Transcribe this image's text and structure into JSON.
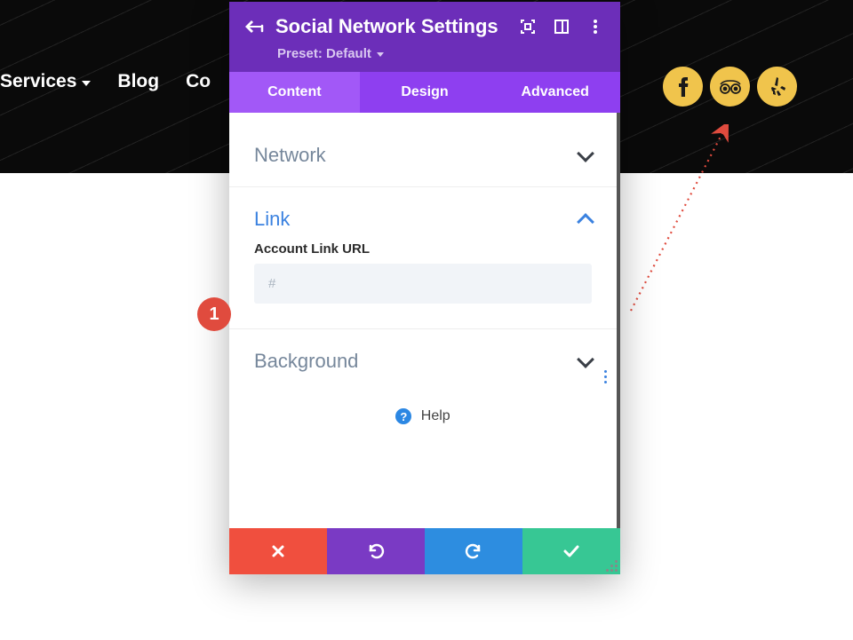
{
  "nav": {
    "items": [
      "Services",
      "Blog",
      "Co"
    ],
    "has_dropdown": [
      true,
      false,
      false
    ]
  },
  "social_icons": [
    "facebook",
    "tripadvisor",
    "yelp"
  ],
  "modal": {
    "title": "Social Network Settings",
    "preset_label": "Preset: Default",
    "tabs": [
      "Content",
      "Design",
      "Advanced"
    ],
    "active_tab": 0,
    "sections": {
      "network": {
        "title": "Network",
        "expanded": false
      },
      "link": {
        "title": "Link",
        "expanded": true,
        "field_label": "Account Link URL",
        "placeholder": "#",
        "value": ""
      },
      "background": {
        "title": "Background",
        "expanded": false
      }
    },
    "help_label": "Help"
  },
  "annotation": {
    "badge": "1"
  }
}
